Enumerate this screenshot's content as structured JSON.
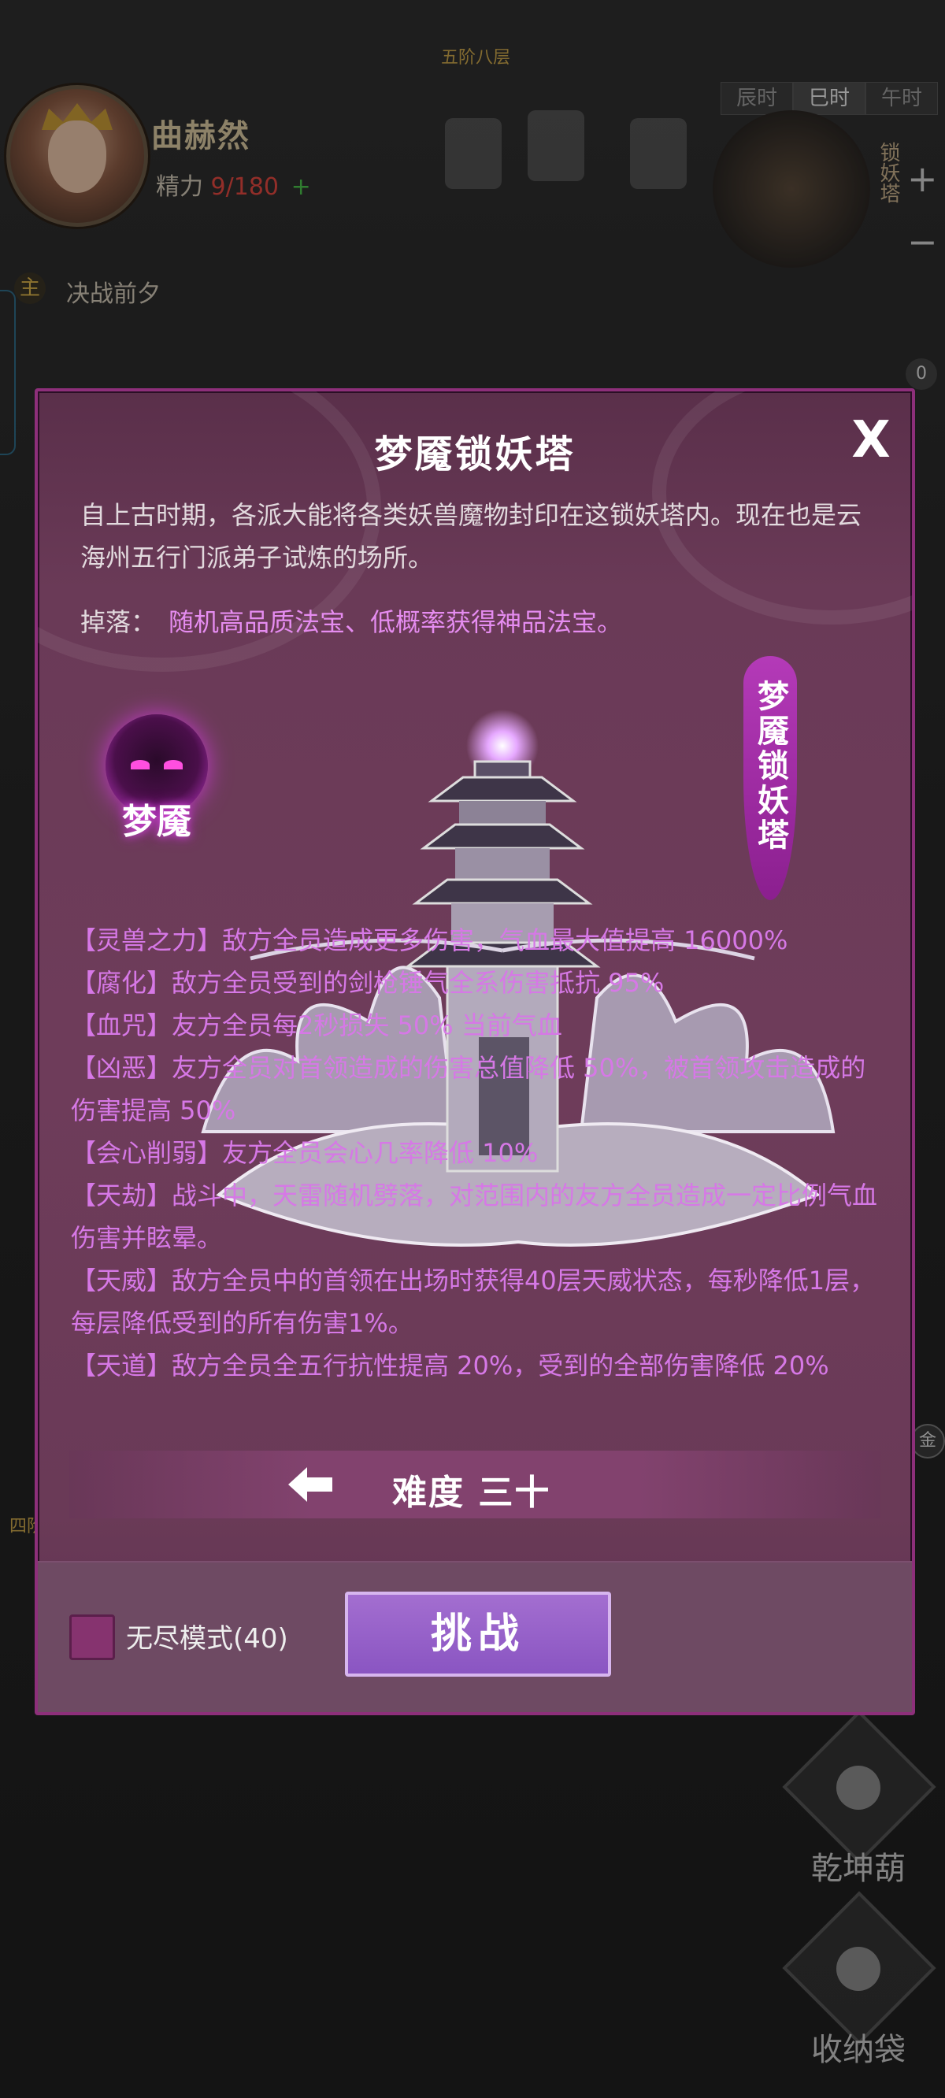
{
  "world": {
    "location": "五阶八层",
    "player": {
      "name": "曲赫然",
      "energy_label": "精力",
      "energy_value": "9/180",
      "energy_plus": "+"
    },
    "time_tabs": [
      "辰时",
      "巳时",
      "午时"
    ],
    "tower_label": "锁妖塔",
    "zoom_plus": "+",
    "zoom_minus": "−",
    "quest": {
      "badge": "主",
      "title": "决战前夕"
    },
    "counter": "0",
    "side_buttons": [
      "乾坤葫",
      "收纳袋"
    ],
    "map_label_left": "四阶",
    "map_label_right": "金"
  },
  "modal": {
    "title": "梦魇锁妖塔",
    "close": "X",
    "description": "自上古时期，各派大能将各类妖兽魔物封印在这锁妖塔内。现在也是云海州五行门派弟子试炼的场所。",
    "drops_label": "掉落：",
    "drops_value": "随机高品质法宝、低概率获得神品法宝。",
    "boss_name": "梦魇",
    "tower_banner": "梦魇锁妖塔",
    "effects": [
      "【灵兽之力】敌方全员造成更多伤害，气血最大值提高 16000%",
      "【腐化】敌方全员受到的剑枪锤气全系伤害抵抗 95%",
      "【血咒】友方全员每2秒损失 50% 当前气血",
      "【凶恶】友方全员对首领造成的伤害总值降低 50%，被首领攻击造成的伤害提高 50%",
      "【会心削弱】友方全员会心几率降低 10%",
      "【天劫】战斗中，天雷随机劈落，对范围内的友方全员造成一定比例气血伤害并眩晕。",
      "【天威】敌方全员中的首领在出场时获得40层天威状态，每秒降低1层，每层降低受到的所有伤害1%。",
      "【天道】敌方全员全五行抗性提高 20%，受到的全部伤害降低 20%"
    ],
    "difficulty": "难度 三十",
    "endless_label": "无尽模式(40)",
    "challenge": "挑战"
  },
  "colors": {
    "accent_purple": "#b43ab8",
    "effect_text": "#d678e6",
    "drop_text": "#e58cf0",
    "energy_red": "#e0483f"
  },
  "icons": [
    "close-icon",
    "arrow-left-icon",
    "boss-demon-icon",
    "tower-illustration",
    "gourd-icon",
    "bag-icon"
  ]
}
